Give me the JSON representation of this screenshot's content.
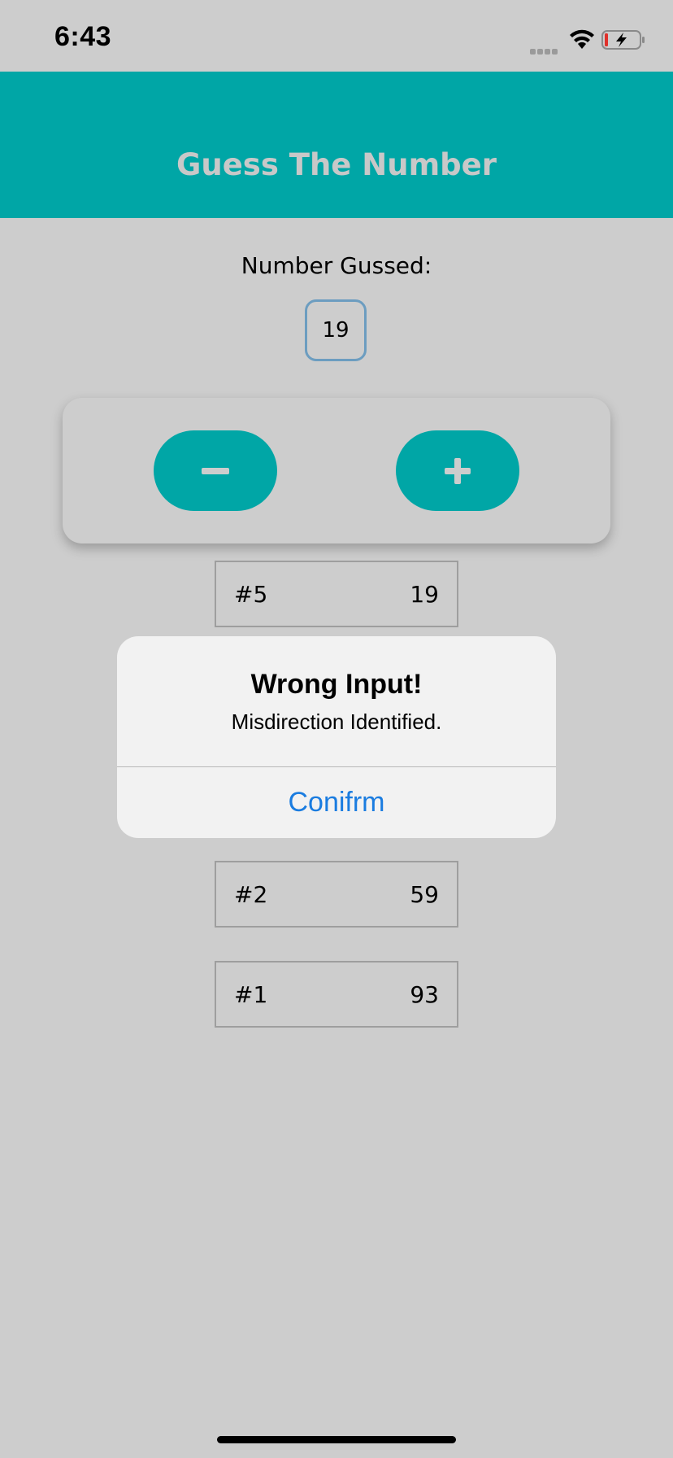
{
  "status_bar": {
    "time": "6:43",
    "icons": [
      "signal-icon",
      "wifi-icon",
      "battery-charging-icon"
    ]
  },
  "header": {
    "title": "Guess The Number",
    "background_color": "#00a6a6",
    "title_color": "#c8c8c8"
  },
  "guess": {
    "label": "Number Gussed:",
    "value": "19"
  },
  "controls": {
    "minus_icon": "minus-icon",
    "plus_icon": "plus-icon",
    "button_color": "#00a6a6"
  },
  "guesses": [
    {
      "index": "#5",
      "value": "19"
    },
    {
      "index": "#2",
      "value": "59"
    },
    {
      "index": "#1",
      "value": "93"
    }
  ],
  "alert": {
    "title": "Wrong Input!",
    "message": "Misdirection Identified.",
    "button_label": "Conifrm",
    "button_color": "#1a7ce0"
  }
}
